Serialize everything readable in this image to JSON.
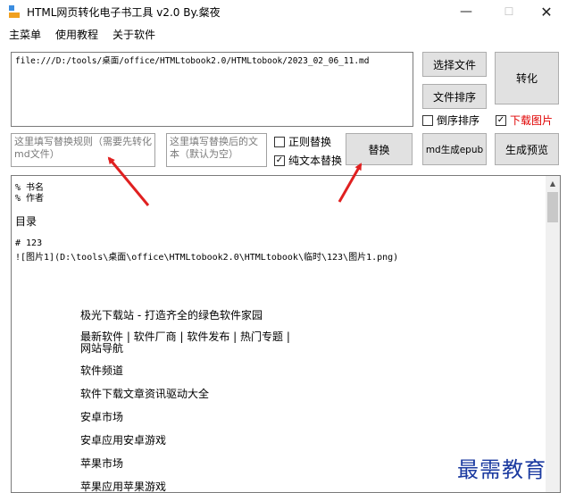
{
  "window": {
    "title": "HTML网页转化电子书工具 v2.0 By.粲夜",
    "minimize_glyph": "—",
    "maximize_glyph": "☐",
    "close_glyph": "✕"
  },
  "menu": {
    "items": [
      "主菜单",
      "使用教程",
      "关于软件"
    ]
  },
  "path_input": {
    "value": "file:///D:/tools/桌面/office/HTMLtobook2.0/HTMLtobook/2023_02_06_11.md"
  },
  "buttons": {
    "select_file": "选择文件",
    "file_sort": "文件排序",
    "convert": "转化",
    "replace": "替换",
    "md_to_epub": "md生成epub",
    "generate_preview": "生成预览"
  },
  "checkboxes": {
    "reverse_sort": {
      "label": "倒序排序",
      "checked": false
    },
    "download_images": {
      "label": "下载图片",
      "checked": true
    },
    "regex_replace": {
      "label": "正则替换",
      "checked": false
    },
    "plain_text_replace": {
      "label": "纯文本替换",
      "checked": true
    }
  },
  "replace_rule": {
    "placeholder": "这里填写替换规则（需要先转化md文件）"
  },
  "replace_after": {
    "placeholder": "这里填写替换后的文本（默认为空）"
  },
  "editor": {
    "lines": [
      "% 书名",
      "% 作者",
      "目录",
      "# 123",
      "![图片1](D:\\tools\\桌面\\office\\HTMLtobook2.0\\HTMLtobook\\临时\\123\\图片1.png)",
      "极光下载站 - 打造齐全的绿色软件家园",
      "最新软件 | 软件厂商 | 软件发布 | 热门专题 |",
      "网站导航",
      "软件频道",
      "软件下载文章资讯驱动大全",
      "安卓市场",
      "安卓应用安卓游戏",
      "苹果市场",
      "苹果应用苹果游戏"
    ]
  },
  "watermark": {
    "text": "最需教育"
  },
  "colors": {
    "annotation_arrow": "#e02020",
    "download_label": "#e00000",
    "watermark": "#1b3aa0"
  }
}
